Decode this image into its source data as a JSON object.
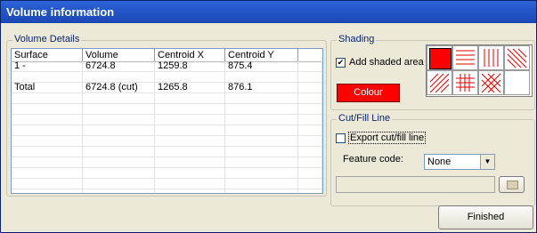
{
  "window": {
    "title": "Volume information"
  },
  "volume_details": {
    "legend": "Volume Details",
    "columns": [
      "Surface",
      "Volume",
      "Centroid X",
      "Centroid Y"
    ],
    "rows": [
      [
        "1 -",
        "6724.8",
        "1259.8",
        "875.4"
      ],
      [
        "",
        "",
        "",
        ""
      ],
      [
        "Total",
        "6724.8 (cut)",
        "1265.8",
        "876.1"
      ]
    ]
  },
  "shading": {
    "legend": "Shading",
    "add_shaded_area_label": "Add shaded area",
    "add_shaded_area_checked": true,
    "colour_button_label": "Colour",
    "colour": "#ff0000",
    "patterns": [
      "solid",
      "horizontal",
      "vertical",
      "diagonal-back",
      "diagonal-forward",
      "cross",
      "diagonal-cross",
      "none"
    ],
    "selected_pattern": "solid"
  },
  "cut_fill": {
    "legend": "Cut/Fill Line",
    "export_label": "Export cut/fill line",
    "export_checked": false,
    "feature_code_label": "Feature code:",
    "feature_code_value": "None",
    "path_value": ""
  },
  "buttons": {
    "finished_label": "Finished"
  },
  "icons": {
    "browse": "folder-icon",
    "dropdown": "chevron-down-icon"
  }
}
